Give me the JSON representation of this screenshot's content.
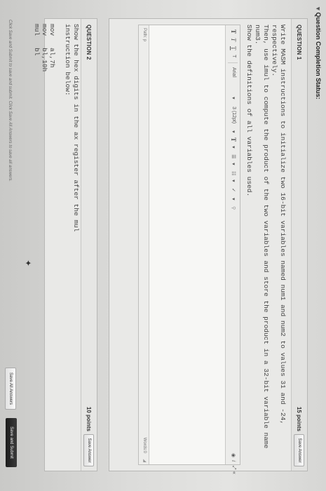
{
  "status": {
    "title": "Question Completion Status:"
  },
  "q1": {
    "title": "QUESTION 1",
    "points": "15 points",
    "save_label": "Save Answer",
    "prompt": "Write MASM instructions to initialize two 16-bit variables named num1 and num2 to values 31 and -24, respectively.\nThen, use imul to compute the product of the two variables and store the product in a 32-bit variable name num3.\nShow the definitions of all variables used.",
    "toolbar": {
      "font": "Arial",
      "size": "3 (12pt)"
    },
    "path_label": "Path: p",
    "words_label": "Words:0"
  },
  "q2": {
    "title": "QUESTION 2",
    "points": "10 points",
    "save_label": "Save Answer",
    "prompt": "Show the hex digits in the ax register after the mul\ninstruction below:",
    "code": [
      {
        "op": "mov",
        "args": "al,7h"
      },
      {
        "op": "mov",
        "args": "bl,10h"
      },
      {
        "op": "mul",
        "args": "bl"
      }
    ]
  },
  "footer": {
    "note": "Click Save and Submit to save and submit. Click Save All Answers to save all answers.",
    "save_all_label": "Save All Answers",
    "save_submit_label": "Save and Submit"
  }
}
